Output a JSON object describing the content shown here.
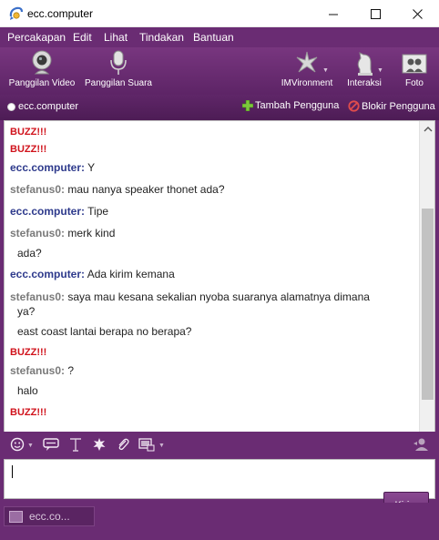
{
  "window": {
    "title": "ecc.computer"
  },
  "menu": [
    "Percakapan",
    "Edit",
    "Lihat",
    "Tindakan",
    "Bantuan"
  ],
  "toolbar": {
    "video_call": "Panggilan Video",
    "voice_call": "Panggilan Suara",
    "imvironment": "IMVironment",
    "interaction": "Interaksi",
    "photo": "Foto"
  },
  "infobar": {
    "contact": "ecc.computer",
    "add_user": "Tambah Pengguna",
    "block_user": "Blokir Pengguna"
  },
  "messages": [
    {
      "type": "buzz",
      "text": "BUZZ!!!"
    },
    {
      "type": "buzz",
      "text": "BUZZ!!!"
    },
    {
      "type": "message",
      "sender": "ecc.computer:",
      "text": "Y"
    },
    {
      "type": "message",
      "sender": "stefanus0:",
      "text": "mau nanya speaker thonet ada?"
    },
    {
      "type": "message",
      "sender": "ecc.computer:",
      "text": "Tipe"
    },
    {
      "type": "message",
      "sender": "stefanus0:",
      "text": "merk kind"
    },
    {
      "type": "continuation",
      "text": "ada?"
    },
    {
      "type": "message",
      "sender": "ecc.computer:",
      "text": "Ada kirim kemana"
    },
    {
      "type": "message",
      "sender": "stefanus0:",
      "text": "saya mau kesana sekalian nyoba suaranya alamatnya dimana"
    },
    {
      "type": "continuation",
      "text": "ya?"
    },
    {
      "type": "continuation",
      "text": "east coast lantai berapa no berapa?"
    },
    {
      "type": "buzz",
      "text": "BUZZ!!!"
    },
    {
      "type": "message",
      "sender": "stefanus0:",
      "text": "?"
    },
    {
      "type": "continuation",
      "text": "halo"
    },
    {
      "type": "buzz",
      "text": "BUZZ!!!"
    }
  ],
  "input": {
    "send_label": "Kirim"
  },
  "tabs": [
    {
      "label": "ecc.co..."
    }
  ],
  "colors": {
    "chrome": "#6a2c73",
    "buzz": "#d0121b",
    "self": "#2e3a8c",
    "other": "#7a7a7a"
  },
  "icons": [
    "messenger-logo-icon",
    "webcam-icon",
    "microphone-icon",
    "imvironment-icon",
    "chess-knight-icon",
    "photo-icon",
    "smiley-icon",
    "speech-bubble-icon",
    "text-format-icon",
    "buzz-icon",
    "paperclip-icon",
    "share-screen-icon",
    "contact-person-icon"
  ]
}
